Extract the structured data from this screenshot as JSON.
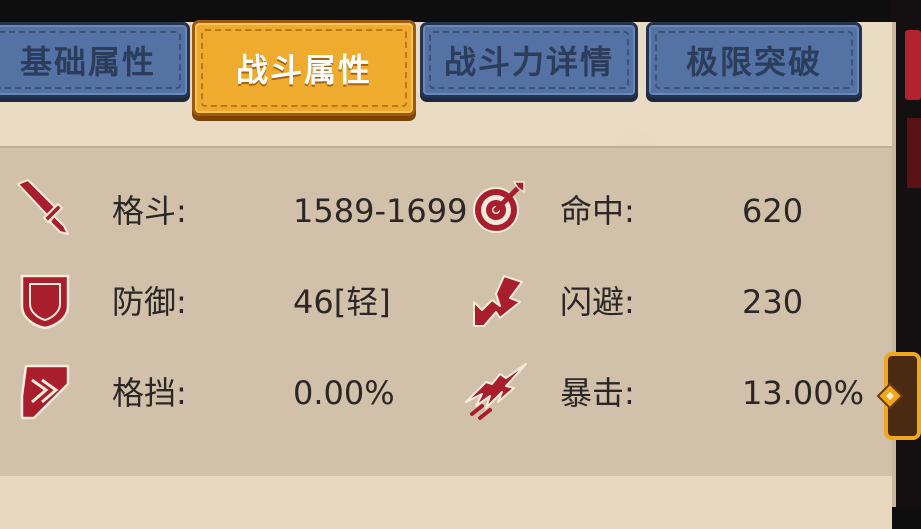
{
  "tabs": [
    {
      "label": "基础属性",
      "active": false
    },
    {
      "label": "战斗属性",
      "active": true
    },
    {
      "label": "战斗力详情",
      "active": false
    },
    {
      "label": "极限突破",
      "active": false
    }
  ],
  "stats": {
    "fight": {
      "label": "格斗:",
      "value": "1589-1699",
      "icon": "sword-icon"
    },
    "hit": {
      "label": "命中:",
      "value": "620",
      "icon": "target-icon"
    },
    "defense": {
      "label": "防御:",
      "value": "46[轻]",
      "icon": "shield-icon"
    },
    "dodge": {
      "label": "闪避:",
      "value": "230",
      "icon": "dodge-arrow-icon"
    },
    "block": {
      "label": "格挡:",
      "value": "0.00%",
      "icon": "block-chevron-icon"
    },
    "crit": {
      "label": "暴击:",
      "value": "13.00%",
      "icon": "crit-burst-icon"
    }
  },
  "colors": {
    "icon_red": "#a81e2c",
    "tab_active": "#efab2d",
    "tab_inactive": "#5472a3",
    "panel_bg": "#eadcc4",
    "stats_bg": "#d2c1aa",
    "text": "#2c2626",
    "arrow_gold": "#f1a71b"
  }
}
